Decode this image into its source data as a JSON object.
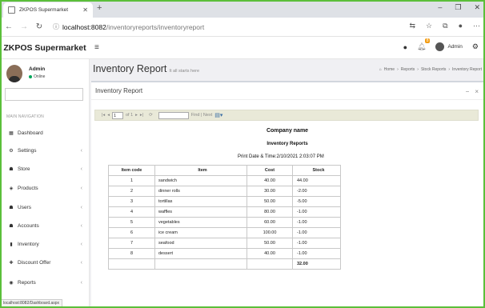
{
  "browser": {
    "tab_title": "ZKPOS Supermarket",
    "url_host": "localhost:8082",
    "url_path": "/inventoryreports/inventoryreport"
  },
  "header": {
    "brand": "ZKPOS Supermarket",
    "notification_count": "8",
    "user": "Admin"
  },
  "sidebar": {
    "user_name": "Admin",
    "user_status": "Online",
    "nav_header": "MAIN NAVIGATION",
    "items": [
      {
        "label": "Dashboard",
        "icon": "dashboard-icon"
      },
      {
        "label": "Settings",
        "icon": "gear-icon"
      },
      {
        "label": "Store",
        "icon": "store-icon"
      },
      {
        "label": "Products",
        "icon": "products-icon"
      },
      {
        "label": "Users",
        "icon": "users-icon"
      },
      {
        "label": "Accounts",
        "icon": "accounts-icon"
      },
      {
        "label": "Inventory",
        "icon": "inventory-icon"
      },
      {
        "label": "Discount Offer",
        "icon": "plus-icon"
      },
      {
        "label": "Reports",
        "icon": "eye-icon"
      }
    ],
    "status_url": "localhost:8082/Dashboard.aspx"
  },
  "content": {
    "page_title": "Inventory Report",
    "page_subtitle": "It all starts here",
    "breadcrumb": [
      "Home",
      "Reports",
      "Stock Reports",
      "Inventory Report"
    ],
    "box_title": "Inventory Report"
  },
  "viewer": {
    "page_value": "1",
    "page_of": "of 1",
    "find_label": "Find | Next"
  },
  "report": {
    "company": "Company name",
    "title": "Inventory Reports",
    "print_date": "Print Date & Time:2/10/2021 2:03:07 PM",
    "columns": [
      "Item code",
      "Item",
      "Cost",
      "Stock"
    ],
    "rows": [
      [
        "1",
        "sandwich",
        "40.00",
        "44.00"
      ],
      [
        "2",
        "dinner rolls",
        "30.00",
        "-2.00"
      ],
      [
        "3",
        "tortillas",
        "50.00",
        "-5.00"
      ],
      [
        "4",
        "waffles",
        "80.00",
        "-1.00"
      ],
      [
        "5",
        "vegetables",
        "60.00",
        "-1.00"
      ],
      [
        "6",
        "ice cream",
        "100.00",
        "-1.00"
      ],
      [
        "7",
        "seafood",
        "50.00",
        "-1.00"
      ],
      [
        "8",
        "dessert",
        "40.00",
        "-1.00"
      ]
    ],
    "total": "32.00"
  }
}
